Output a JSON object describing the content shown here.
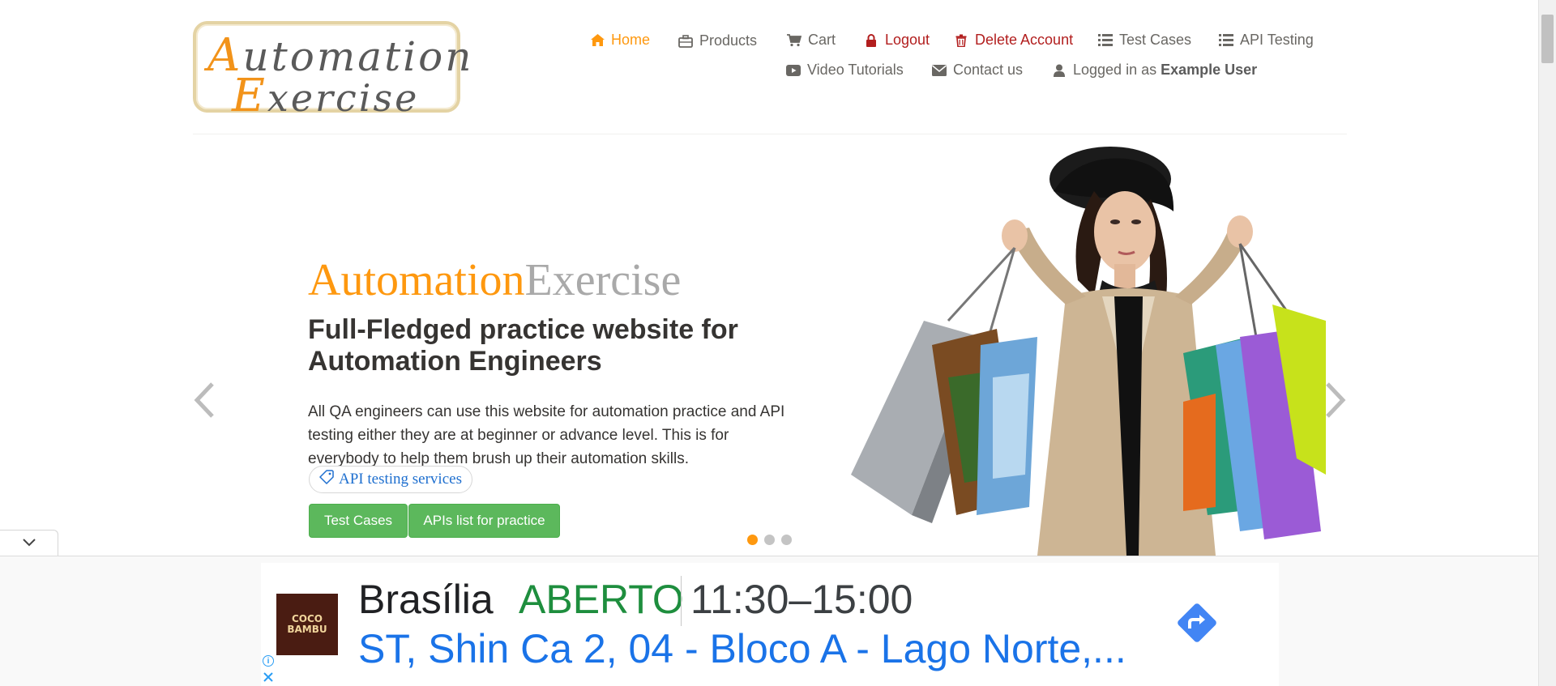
{
  "header": {
    "logo_line1_first": "A",
    "logo_line1_rest": "utomation",
    "logo_line2_first": "E",
    "logo_line2_rest": "xercise"
  },
  "nav": {
    "home": "Home",
    "products": "Products",
    "cart": "Cart",
    "logout": "Logout",
    "delete_account": "Delete Account",
    "test_cases": "Test Cases",
    "api_testing": "API Testing",
    "video_tutorials": "Video Tutorials",
    "contact_us": "Contact us",
    "logged_in_prefix": "Logged in as",
    "logged_in_user": "Example User"
  },
  "slider": {
    "brand_part1": "Automation",
    "brand_part2": "Exercise",
    "headline": "Full-Fledged practice website for Automation Engineers",
    "description": "All QA engineers can use this website for automation practice and API testing either they are at beginner or advance level. This is for everybody to help them brush up their automation skills.",
    "pill_label": "API testing services",
    "btn_test_cases": "Test Cases",
    "btn_apis": "APIs list for practice",
    "active_slide": 1,
    "slide_count": 3
  },
  "ad": {
    "logo_text": "COCO BAMBU",
    "city": "Brasília",
    "status": "ABERTO",
    "hours": "11:30–15:00",
    "address": "ST, Shin Ca 2, 04 - Bloco A - Lago Norte,..."
  },
  "colors": {
    "accent": "#fe980f",
    "danger": "#b21e1e",
    "button_green": "#5cb85c",
    "ad_open": "#1e8e3e",
    "ad_link": "#1a73e8"
  }
}
